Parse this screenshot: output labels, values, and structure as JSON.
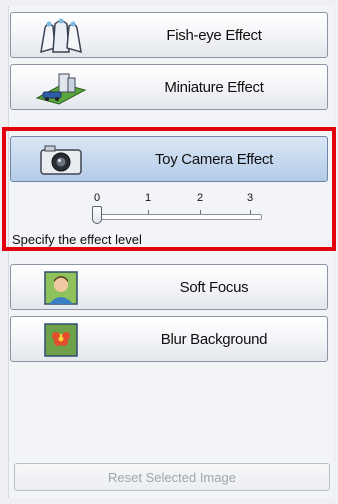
{
  "effects": {
    "fisheye": {
      "label": "Fish-eye Effect",
      "icon": "fisheye-icon"
    },
    "miniature": {
      "label": "Miniature Effect",
      "icon": "miniature-icon"
    },
    "toy_camera": {
      "label": "Toy Camera Effect",
      "icon": "camera-icon",
      "selected": true
    },
    "soft_focus": {
      "label": "Soft Focus",
      "icon": "portrait-icon"
    },
    "blur_background": {
      "label": "Blur Background",
      "icon": "flower-icon"
    }
  },
  "slider": {
    "ticks": [
      "0",
      "1",
      "2",
      "3"
    ],
    "value": 0,
    "caption": "Specify the effect level"
  },
  "reset_button": {
    "label": "Reset Selected Image",
    "enabled": false
  },
  "colors": {
    "highlight_border": "#e3000f",
    "selected_button": "#c7d9ef"
  }
}
